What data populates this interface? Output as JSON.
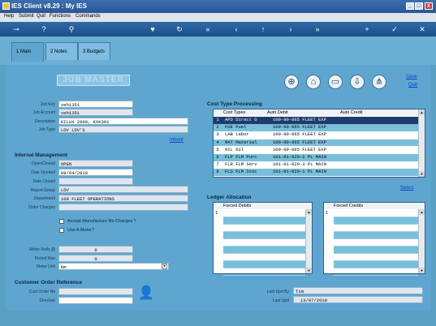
{
  "window": {
    "title": "IES Client v8.29 : My IES",
    "min_glyph": "_",
    "max_glyph": "□",
    "close_glyph": "x"
  },
  "menu": [
    "Help",
    "Submit",
    "Quit",
    "Functions",
    "Commands"
  ],
  "toolbar_icons": [
    "key-icon",
    "help-icon",
    "search-icon",
    "heart-icon",
    "refresh-icon",
    "rewind-icon",
    "back-icon",
    "up-icon",
    "forward-icon",
    "fast-forward-icon",
    "add-icon",
    "check-icon",
    "close-icon"
  ],
  "tabs": [
    "1 Main",
    "2 Notes",
    "3 Budgets"
  ],
  "page": {
    "title": "JOB MASTER",
    "save": "Save",
    "quit": "Quit"
  },
  "header_fields": {
    "job_key": {
      "label": "Job Key",
      "value": "veh1351"
    },
    "job_account": {
      "label": "Job Account",
      "value": "veh1351"
    },
    "description": {
      "label": "Description",
      "value": "KILUX 2000, KXK301"
    },
    "job_type": {
      "label": "Job Type",
      "value": "LDV LDV'S"
    },
    "inherit": "Inherit"
  },
  "internal": {
    "heading": "Internal Management",
    "open_closed": {
      "label": "Open/Closed",
      "value": "OPEN"
    },
    "date_opened": {
      "label": "Date Opened",
      "value": "09/04/2010"
    },
    "date_closed": {
      "label": "Date Closed",
      "value": ""
    },
    "report_group": {
      "label": "Report Group",
      "value": "LDV"
    },
    "department": {
      "label": "Department",
      "value": "109 FLEET OPERATIONS"
    },
    "order_charges": {
      "label": "Order Charges",
      "value": ""
    },
    "accept_recharges": "Accept Manufacture Re-Charges ?",
    "use_meter": "Use A Meter?",
    "meter_rolls": {
      "label": "Meter Rolls @",
      "value": "0"
    },
    "period_max": {
      "label": "Period Max",
      "value": "0"
    },
    "meter_unit": {
      "label": "Meter Unit",
      "value": "Km"
    }
  },
  "customer": {
    "heading": "Customer Order Reference",
    "order_no": {
      "label": "Cust Order No",
      "value": ""
    },
    "directive": {
      "label": "Directive",
      "value": ""
    }
  },
  "cost_types": {
    "heading": "Cost Type Processing",
    "columns": [
      "Cost Types",
      "Auto Debit",
      "Auto Credit"
    ],
    "rows": [
      {
        "n": "1",
        "type": "APD Direct O",
        "debit": "109-00-065 FLEET EXP"
      },
      {
        "n": "2",
        "type": "FUE Fuel",
        "debit": "109-00-065 FLEET EXP"
      },
      {
        "n": "3",
        "type": "LAB Labor",
        "debit": "109-00-065 FLEET EXP"
      },
      {
        "n": "4",
        "type": "MAT Material",
        "debit": "109-00-065 FLEET EXP"
      },
      {
        "n": "5",
        "type": "OIL Oil",
        "debit": "109-00-065 FLEET EXP"
      },
      {
        "n": "6",
        "type": "FLP FLM Purc",
        "debit": "101-01-029-2 PL MAIN"
      },
      {
        "n": "7",
        "type": "FLR FLM Serv",
        "debit": "101-01-029-3 PL MAIN"
      },
      {
        "n": "8",
        "type": "FLS FLM Stoc",
        "debit": "101-01-029-1 PL MAIN"
      }
    ],
    "select": "Select"
  },
  "ledger": {
    "heading": "Ledger Allocation",
    "debits_title": "Forced Debits",
    "credits_title": "Forced Credits",
    "row_num": "1"
  },
  "audit": {
    "last_upd_by": {
      "label": "Last Upd By",
      "value": "Tim"
    },
    "last_upd": {
      "label": "Last Upd",
      "value": "13/07/2010"
    }
  }
}
